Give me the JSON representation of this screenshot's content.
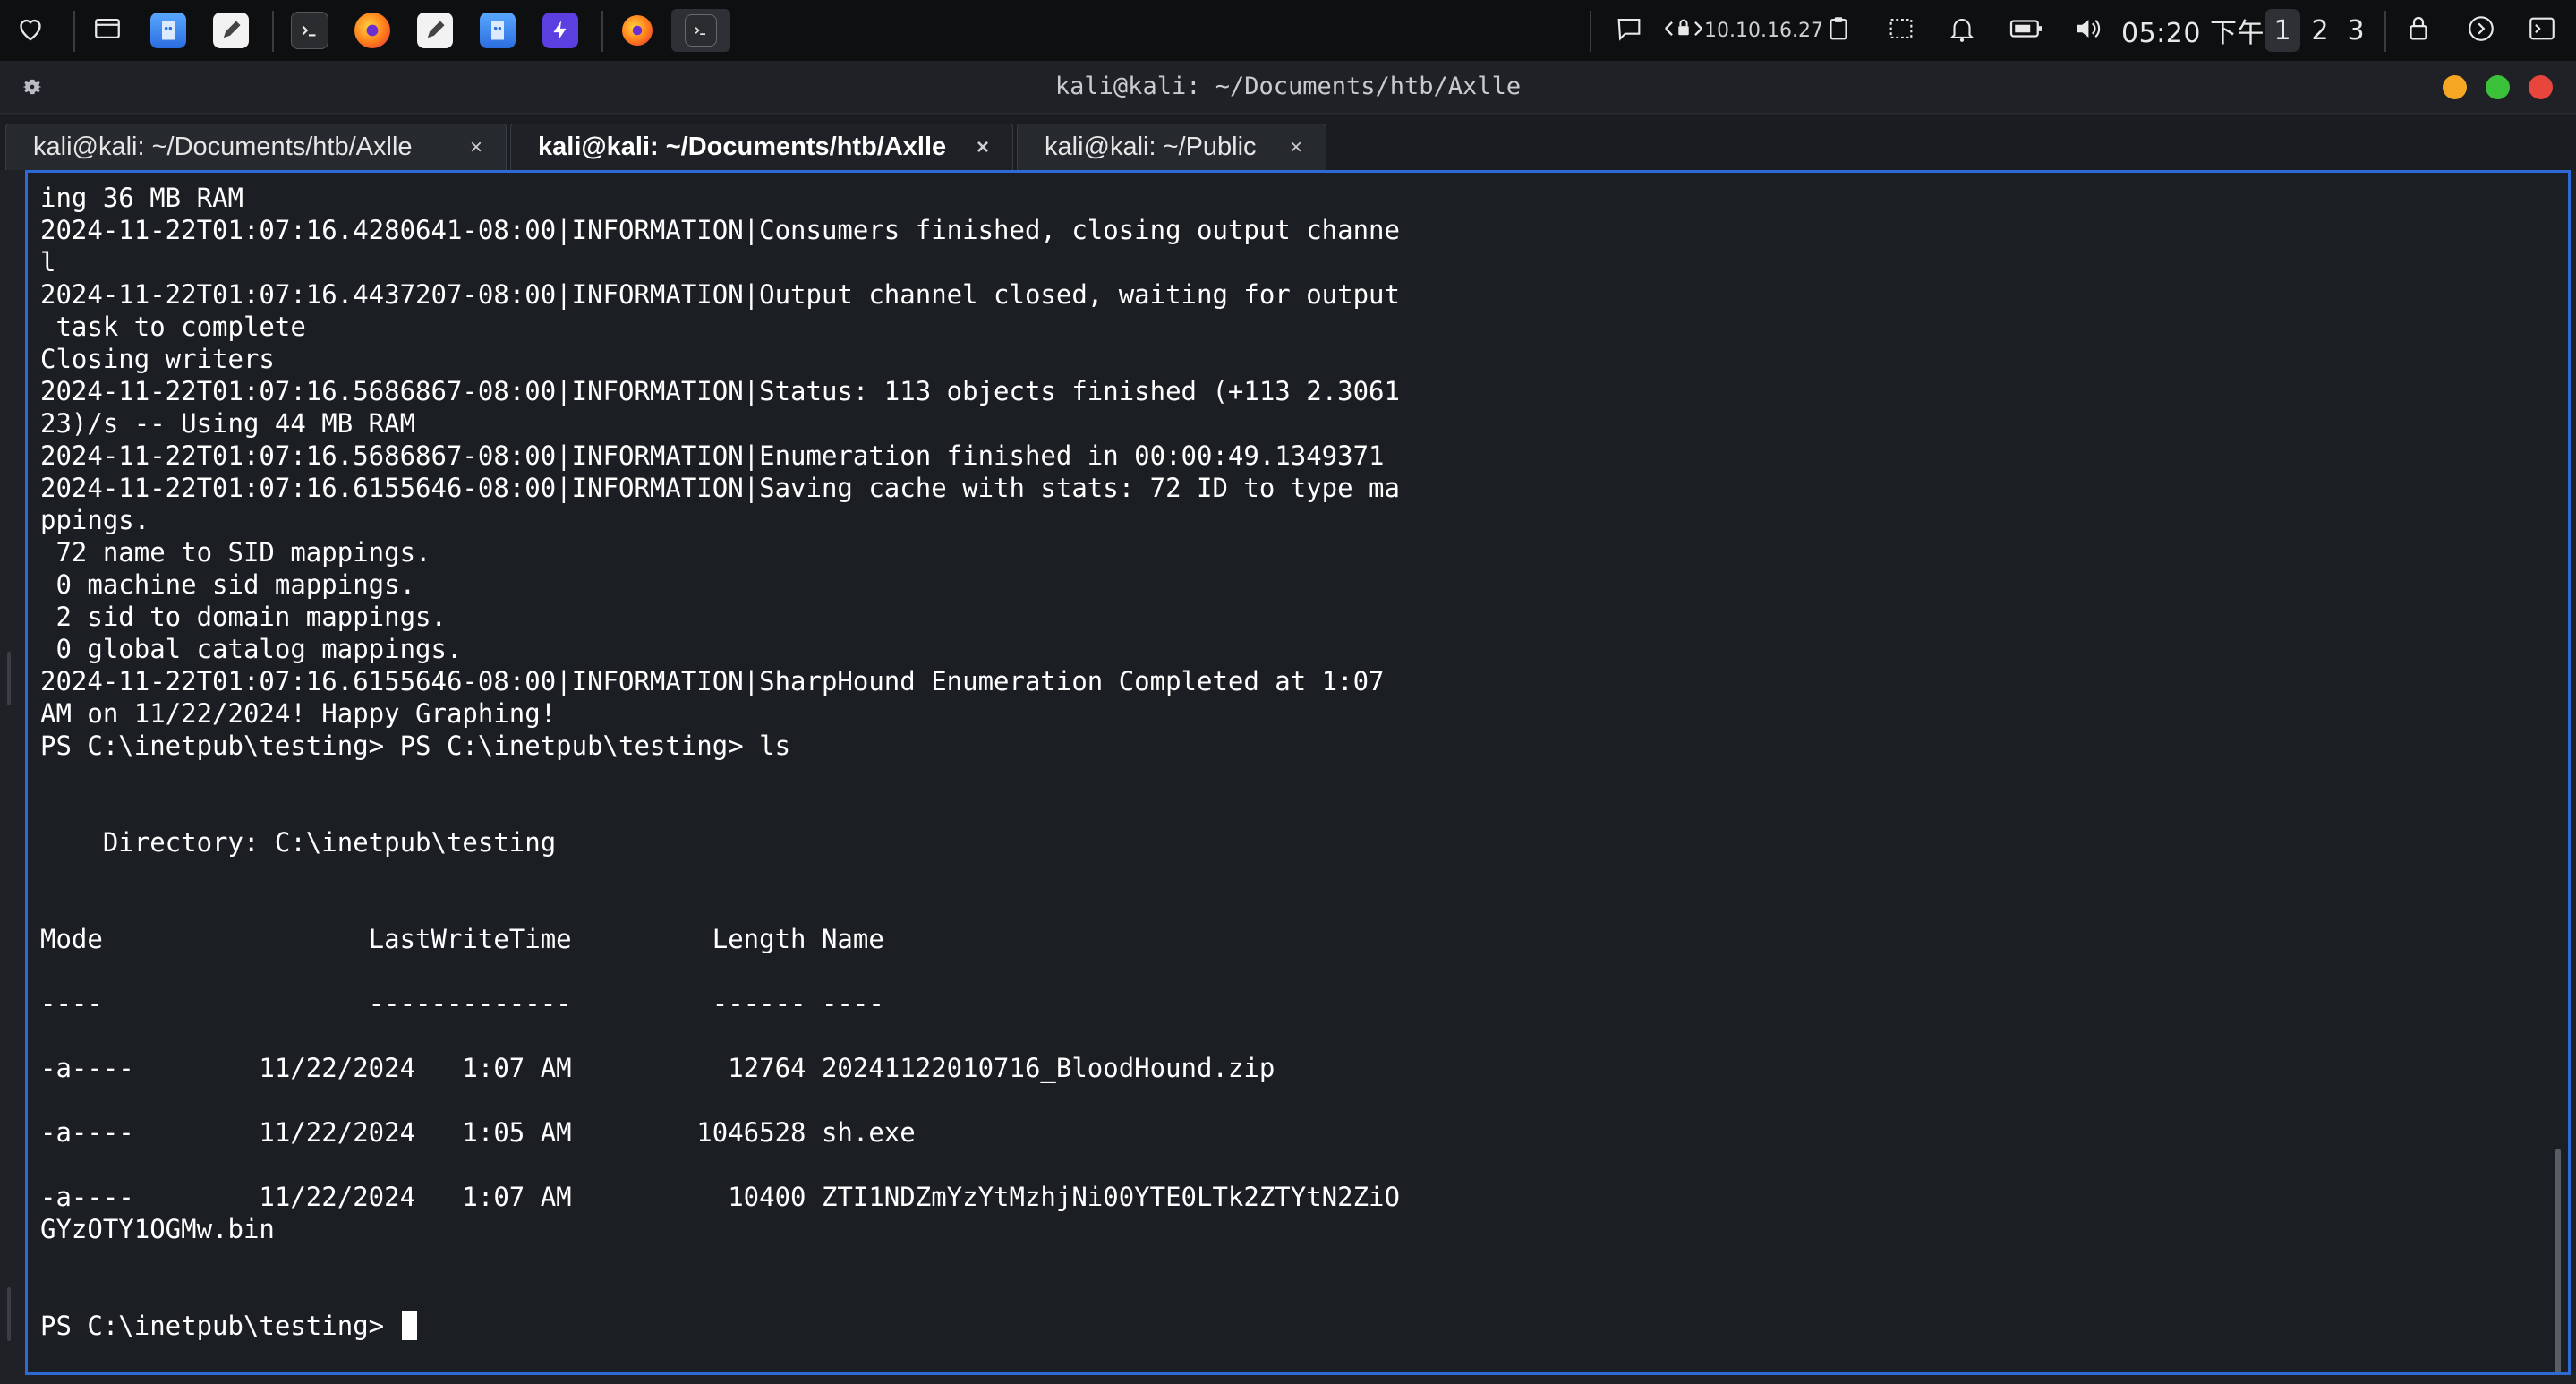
{
  "panel": {
    "launchers": [
      {
        "name": "favorites-icon"
      },
      {
        "name": "show-desktop-icon"
      },
      {
        "name": "file-manager-icon"
      },
      {
        "name": "text-editor-icon"
      },
      {
        "name": "terminal-icon"
      },
      {
        "name": "firefox-icon"
      },
      {
        "name": "text-editor-icon"
      },
      {
        "name": "file-manager-icon"
      },
      {
        "name": "burpsuite-icon"
      },
      {
        "name": "firefox-icon"
      },
      {
        "name": "terminal-icon"
      }
    ],
    "ip": "10.10.16.27",
    "clock": "05:20 下午",
    "workspaces": [
      "1",
      "2",
      "3"
    ],
    "active_workspace": "1",
    "colors": {
      "accent": "#2d6ad6",
      "panel_bg": "#0e0f11"
    }
  },
  "window": {
    "title": "kali@kali: ~/Documents/htb/Axlle",
    "controls": {
      "minimize": "#f5a623",
      "maximize": "#3cc13b",
      "close": "#e8453c"
    }
  },
  "tabs": [
    {
      "label": "kali@kali: ~/Documents/htb/Axlle",
      "close": "×",
      "active": false
    },
    {
      "label": "kali@kali: ~/Documents/htb/Axlle",
      "close": "×",
      "active": true
    },
    {
      "label": "kali@kali: ~/Public",
      "close": "×",
      "active": false
    }
  ],
  "terminal": {
    "lines": [
      "ing 36 MB RAM",
      "2024-11-22T01:07:16.4280641-08:00|INFORMATION|Consumers finished, closing output channe",
      "l",
      "2024-11-22T01:07:16.4437207-08:00|INFORMATION|Output channel closed, waiting for output",
      " task to complete",
      "Closing writers",
      "2024-11-22T01:07:16.5686867-08:00|INFORMATION|Status: 113 objects finished (+113 2.3061",
      "23)/s -- Using 44 MB RAM",
      "2024-11-22T01:07:16.5686867-08:00|INFORMATION|Enumeration finished in 00:00:49.1349371",
      "2024-11-22T01:07:16.6155646-08:00|INFORMATION|Saving cache with stats: 72 ID to type ma",
      "ppings.",
      " 72 name to SID mappings.",
      " 0 machine sid mappings.",
      " 2 sid to domain mappings.",
      " 0 global catalog mappings.",
      "2024-11-22T01:07:16.6155646-08:00|INFORMATION|SharpHound Enumeration Completed at 1:07",
      "AM on 11/22/2024! Happy Graphing!",
      "PS C:\\inetpub\\testing> PS C:\\inetpub\\testing> ls",
      "",
      "",
      "    Directory: C:\\inetpub\\testing",
      "",
      "",
      "Mode                 LastWriteTime         Length Name",
      "",
      "----                 -------------         ------ ----",
      "",
      "-a----        11/22/2024   1:07 AM          12764 20241122010716_BloodHound.zip",
      "",
      "-a----        11/22/2024   1:05 AM        1046528 sh.exe",
      "",
      "-a----        11/22/2024   1:07 AM          10400 ZTI1NDZmYzYtMzhjNi00YTE0LTk2ZTYtN2ZiO",
      "GYzOTY1OGMw.bin",
      "",
      "",
      ""
    ],
    "prompt": "PS C:\\inetpub\\testing> "
  }
}
